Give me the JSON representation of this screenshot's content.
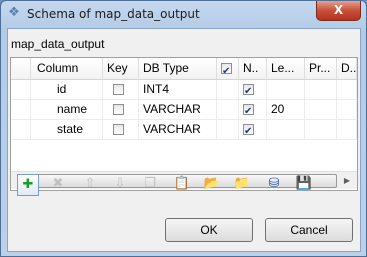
{
  "window": {
    "title": "Schema of map_data_output",
    "close_symbol": "X",
    "app_icon": "puzzle-icon"
  },
  "schema_name": "map_data_output",
  "table": {
    "headers": {
      "column": "Column",
      "key": "Key",
      "db_type": "DB Type",
      "nullable": "N..",
      "length": "Le...",
      "precision": "Pr...",
      "default": "D..."
    },
    "rows": [
      {
        "column": "id",
        "key": false,
        "db_type": "INT4",
        "nullable": true,
        "length": "",
        "precision": "",
        "default": ""
      },
      {
        "column": "name",
        "key": false,
        "db_type": "VARCHAR",
        "nullable": true,
        "length": "20",
        "precision": "",
        "default": ""
      },
      {
        "column": "state",
        "key": false,
        "db_type": "VARCHAR",
        "nullable": true,
        "length": "",
        "precision": "",
        "default": ""
      }
    ],
    "scroll_grip": "|||"
  },
  "toolbar": [
    {
      "name": "add-icon",
      "glyph": "✚",
      "enabled": true
    },
    {
      "name": "delete-icon",
      "glyph": "✖",
      "enabled": false
    },
    {
      "name": "move-up-icon",
      "glyph": "⇧",
      "enabled": false
    },
    {
      "name": "move-down-icon",
      "glyph": "⇩",
      "enabled": false
    },
    {
      "name": "copy-icon",
      "glyph": "❐",
      "enabled": false
    },
    {
      "name": "paste-icon",
      "glyph": "📋",
      "enabled": false
    },
    {
      "name": "import-icon",
      "glyph": "📂",
      "enabled": true
    },
    {
      "name": "export-icon",
      "glyph": "📁",
      "enabled": true
    },
    {
      "name": "database-icon",
      "glyph": "⛁",
      "enabled": true
    },
    {
      "name": "save-icon",
      "glyph": "💾",
      "enabled": true
    }
  ],
  "buttons": {
    "ok": "OK",
    "cancel": "Cancel"
  }
}
